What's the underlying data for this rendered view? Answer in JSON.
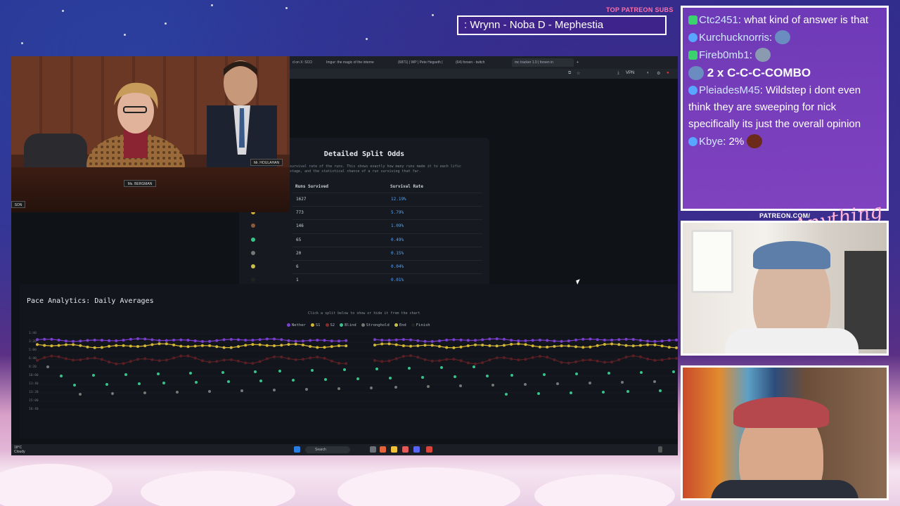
{
  "overlay": {
    "patreon_top": "TOP PATREON SUBS",
    "now_playing": ": Wrynn -  Noba D - Mephestia",
    "patreon_mid": "PATREON.COM/",
    "signature": "Anything Else?"
  },
  "browser": {
    "tabs": [
      {
        "label": "d on X: SCO"
      },
      {
        "label": "Imgur: the magic of the interne"
      },
      {
        "label": "(6871) | WP | Pete Hegseth |"
      },
      {
        "label": "(64) forsen - twitch"
      },
      {
        "label": "mc tracker 1.0 | forsen in"
      }
    ],
    "address_icons": [
      "download-icon",
      "vpn-badge",
      "extensions-icon"
    ],
    "vpn": "VPN"
  },
  "split_odds": {
    "title": "Detailed Split Odds",
    "description": "survival rate of the runs. This shows exactly how many runs made it to each lific stage, and the statistical chance of a run surviving that far.",
    "col_runs": "Runs Survived",
    "col_rate": "Survival Rate",
    "rows": [
      {
        "runs": "1627",
        "rate": "12.19%",
        "color": "#7b3fd0"
      },
      {
        "runs": "773",
        "rate": "5.79%",
        "color": "#d4b636"
      },
      {
        "runs": "146",
        "rate": "1.09%",
        "color": "#8a5a3a"
      },
      {
        "runs": "65",
        "rate": "0.49%",
        "color": "#37c48a"
      },
      {
        "runs": "20",
        "rate": "0.15%",
        "color": "#777777"
      },
      {
        "runs": "6",
        "rate": "0.04%",
        "color": "#c9c04a"
      },
      {
        "runs": "1",
        "rate": "0.01%",
        "color": "#222222"
      }
    ]
  },
  "analytics": {
    "title": "Pace Analytics: Daily Averages",
    "hint": "Click a split below to show or hide it from the chart",
    "legend": [
      {
        "label": "Nether",
        "color": "#7b3fd0"
      },
      {
        "label": "S1",
        "color": "#d4b636"
      },
      {
        "label": "S2",
        "color": "#8a2a2a"
      },
      {
        "label": "Blind",
        "color": "#37c48a"
      },
      {
        "label": "Stronghold",
        "color": "#777777"
      },
      {
        "label": "End",
        "color": "#c9c04a"
      },
      {
        "label": "Finish",
        "color": "#222222"
      }
    ],
    "y_ticks": [
      "1:40",
      "3:20",
      "5:00",
      "6:40",
      "8:20",
      "10:00",
      "11:40",
      "13:20",
      "15:00",
      "16:40"
    ]
  },
  "taskbar": {
    "weather_temp": "18°C",
    "weather_desc": "Cloudy",
    "search": "Search"
  },
  "chat": {
    "messages": [
      {
        "user": "Ctc2451",
        "text": ": what kind of answer is that",
        "badge_color": "#3bd16f"
      },
      {
        "user": "Kurchucknorris",
        "text": ":",
        "badge_color": "#58a6ff"
      },
      {
        "user": "Fireb0mb1",
        "text": ":",
        "badge_color": "#3bd16f"
      },
      {
        "user": "",
        "text": "2 x C-C-C-COMBO",
        "badge_color": ""
      },
      {
        "user": "PleiadesM45",
        "text": ": Wildstep i dont even think they are sweeping for nick specifically  its just the overall opinion",
        "badge_color": "#58a6ff"
      },
      {
        "user": "Kbye",
        "text": ": 2%",
        "badge_color": "#58a6ff"
      }
    ]
  },
  "hearing": {
    "nameplate_left": "Ms. BERGMAN",
    "nameplate_right": "Mr. HOULAHAN",
    "nameplate_edge": "SON"
  }
}
